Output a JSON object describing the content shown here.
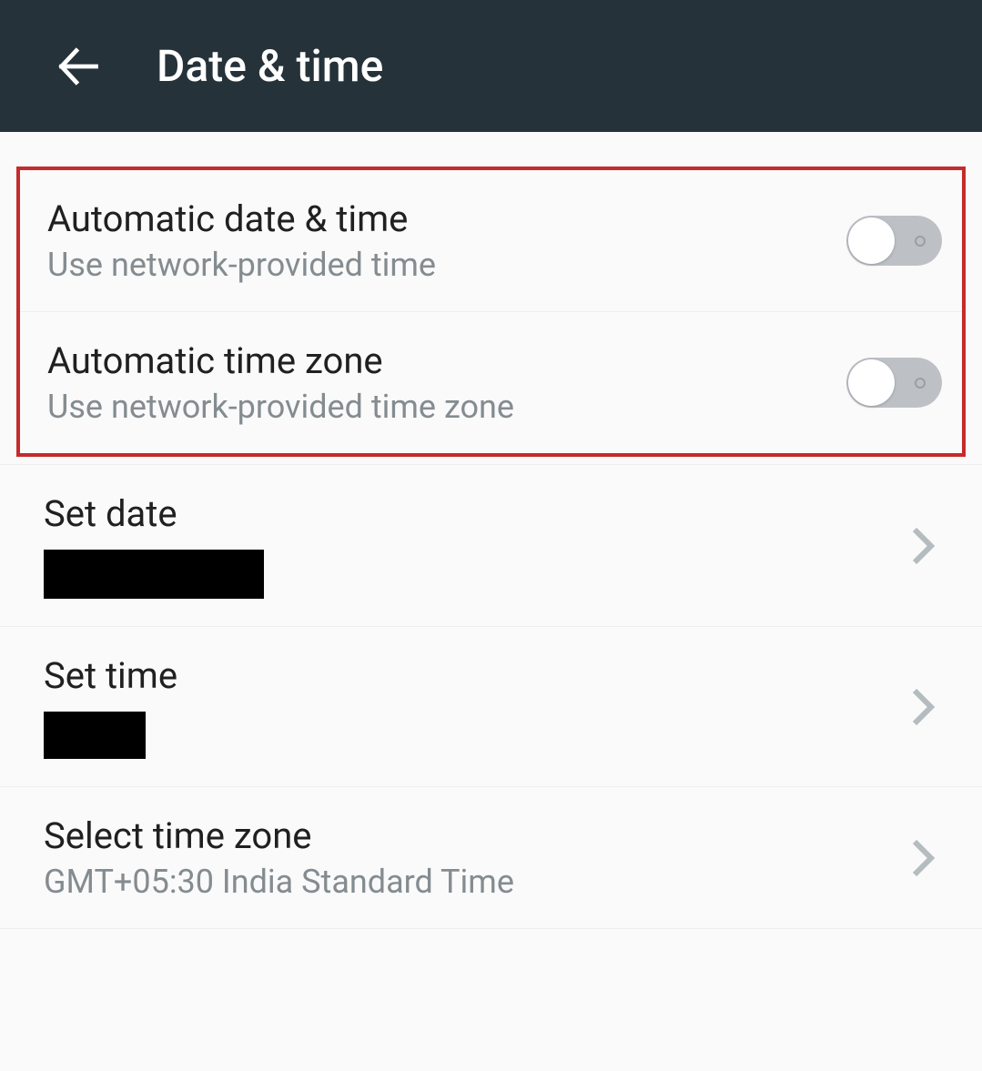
{
  "header": {
    "title": "Date & time"
  },
  "settings": {
    "auto_date_time": {
      "title": "Automatic date & time",
      "subtitle": "Use network-provided time",
      "toggled": false
    },
    "auto_time_zone": {
      "title": "Automatic time zone",
      "subtitle": "Use network-provided time zone",
      "toggled": false
    },
    "set_date": {
      "title": "Set date"
    },
    "set_time": {
      "title": "Set time"
    },
    "select_time_zone": {
      "title": "Select time zone",
      "subtitle": "GMT+05:30 India Standard Time"
    }
  }
}
